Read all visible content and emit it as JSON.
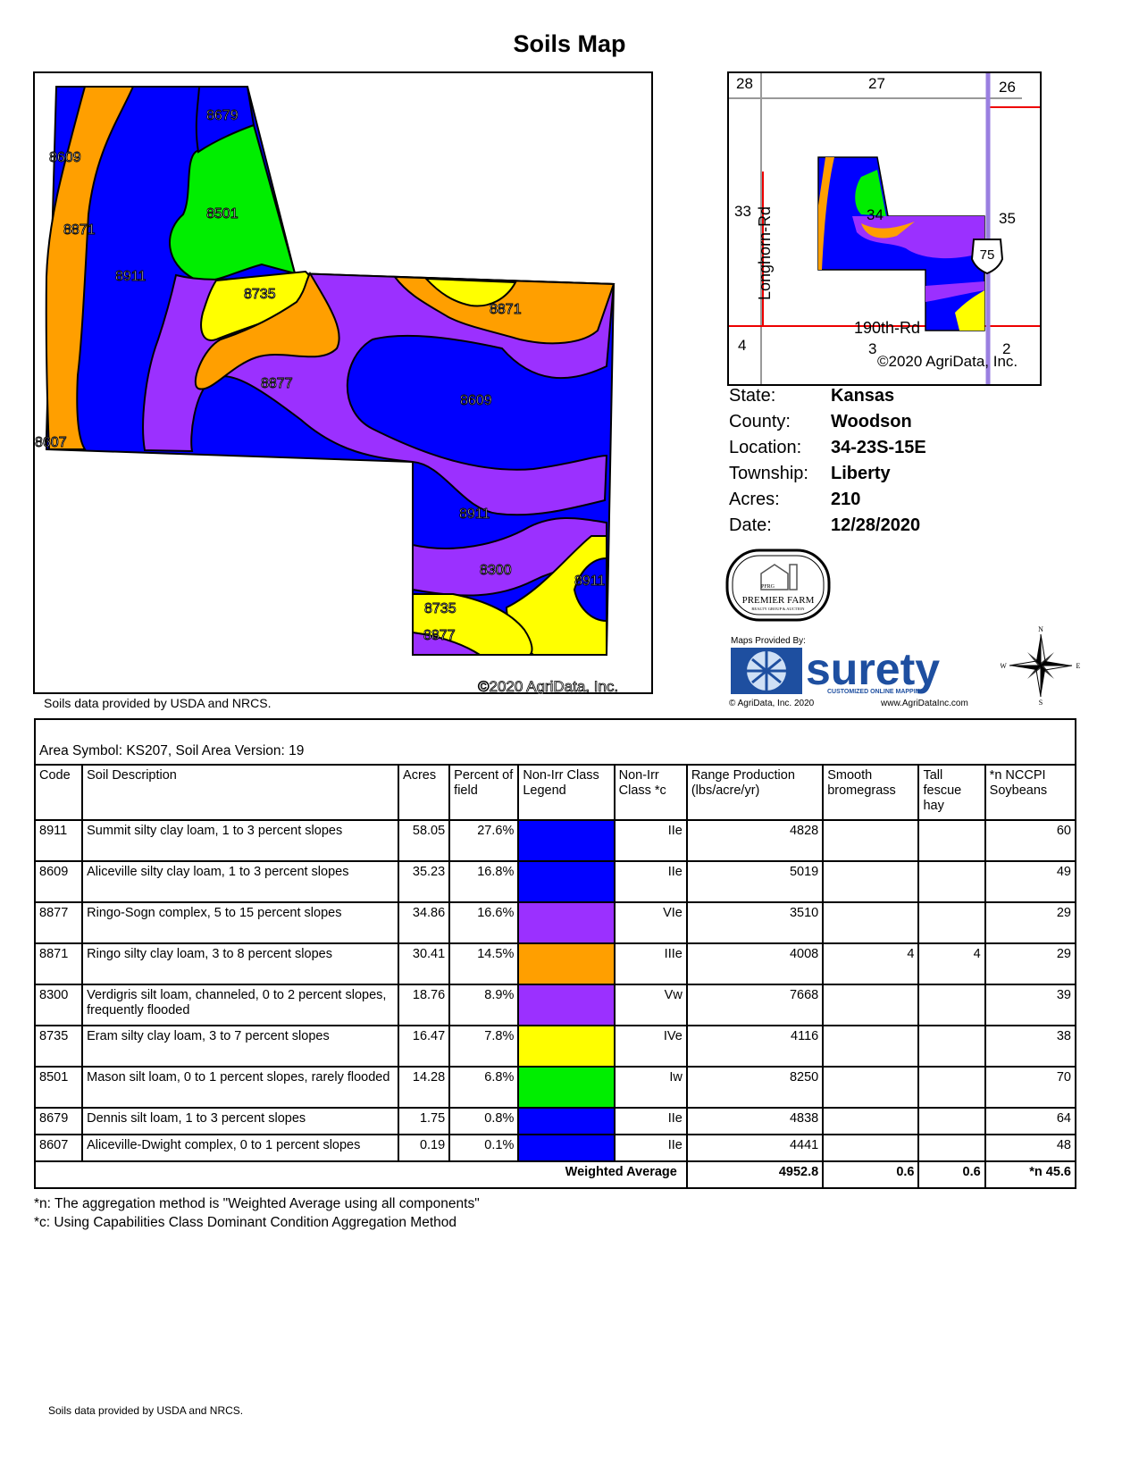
{
  "title": "Soils Map",
  "main_map": {
    "labels": [
      "8679",
      "8609",
      "8501",
      "8871",
      "8911",
      "8735",
      "8871",
      "8877",
      "8609",
      "8607",
      "8911",
      "8300",
      "8911",
      "8735",
      "8877"
    ],
    "copyright": "©2020 AgriData, Inc.",
    "colors": {
      "blue": "#0000ff",
      "purple": "#9b30ff",
      "orange": "#ff9f00",
      "yellow": "#ffff00",
      "green": "#00ee00"
    }
  },
  "main_credit": "Soils data provided by USDA and NRCS.",
  "locator": {
    "section_labels": [
      "28",
      "27",
      "26",
      "33",
      "34",
      "35",
      "4",
      "3",
      "2"
    ],
    "road_labels": [
      "Longhorn-Rd",
      "190th-Rd"
    ],
    "highway": "75",
    "copyright": "©2020 AgriData, Inc."
  },
  "info": {
    "rows": [
      {
        "label": "State:",
        "value": "Kansas"
      },
      {
        "label": "County:",
        "value": "Woodson"
      },
      {
        "label": "Location:",
        "value": "34-23S-15E"
      },
      {
        "label": "Township:",
        "value": "Liberty"
      },
      {
        "label": "Acres:",
        "value": "210"
      },
      {
        "label": "Date:",
        "value": "12/28/2020"
      }
    ]
  },
  "logos": {
    "pfrg_small": "PFRG",
    "pfrg_name": "PREMIER FARM",
    "pfrg_sub": "REALTY GROUP & AUCTION",
    "maps_provided_by": "Maps Provided By:",
    "surety": "surety",
    "surety_tag": "CUSTOMIZED ONLINE MAPPING",
    "copyright": "© AgriData, Inc. 2020",
    "url": "www.AgriDataInc.com"
  },
  "compass": {
    "n": "N",
    "s": "S",
    "e": "E",
    "w": "W"
  },
  "table": {
    "area_symbol": "Area Symbol: KS207, Soil Area Version: 19",
    "headers": [
      "Code",
      "Soil Description",
      "Acres",
      "Percent of field",
      "Non-Irr Class Legend",
      "Non-Irr Class *c",
      "Range Production (lbs/acre/yr)",
      "Smooth bromegrass",
      "Tall fescue hay",
      "*n NCCPI Soybeans"
    ],
    "rows": [
      {
        "code": "8911",
        "desc": "Summit silty clay loam, 1 to 3 percent slopes",
        "acres": "58.05",
        "pct": "27.6%",
        "color": "#0000ff",
        "cls": "IIe",
        "range": "4828",
        "brome": "",
        "fescue": "",
        "nccpi": "60"
      },
      {
        "code": "8609",
        "desc": "Aliceville silty clay loam, 1 to 3 percent slopes",
        "acres": "35.23",
        "pct": "16.8%",
        "color": "#0000ff",
        "cls": "IIe",
        "range": "5019",
        "brome": "",
        "fescue": "",
        "nccpi": "49"
      },
      {
        "code": "8877",
        "desc": "Ringo-Sogn complex, 5 to 15 percent slopes",
        "acres": "34.86",
        "pct": "16.6%",
        "color": "#9b30ff",
        "cls": "VIe",
        "range": "3510",
        "brome": "",
        "fescue": "",
        "nccpi": "29"
      },
      {
        "code": "8871",
        "desc": "Ringo silty clay loam, 3 to 8 percent slopes",
        "acres": "30.41",
        "pct": "14.5%",
        "color": "#ff9f00",
        "cls": "IIIe",
        "range": "4008",
        "brome": "4",
        "fescue": "4",
        "nccpi": "29"
      },
      {
        "code": "8300",
        "desc": "Verdigris silt loam, channeled, 0 to 2 percent slopes, frequently flooded",
        "acres": "18.76",
        "pct": "8.9%",
        "color": "#9b30ff",
        "cls": "Vw",
        "range": "7668",
        "brome": "",
        "fescue": "",
        "nccpi": "39"
      },
      {
        "code": "8735",
        "desc": "Eram silty clay loam, 3 to 7 percent slopes",
        "acres": "16.47",
        "pct": "7.8%",
        "color": "#ffff00",
        "cls": "IVe",
        "range": "4116",
        "brome": "",
        "fescue": "",
        "nccpi": "38"
      },
      {
        "code": "8501",
        "desc": "Mason silt loam, 0 to 1 percent slopes, rarely flooded",
        "acres": "14.28",
        "pct": "6.8%",
        "color": "#00ee00",
        "cls": "Iw",
        "range": "8250",
        "brome": "",
        "fescue": "",
        "nccpi": "70"
      },
      {
        "code": "8679",
        "desc": "Dennis silt loam, 1 to 3 percent slopes",
        "acres": "1.75",
        "pct": "0.8%",
        "color": "#0000ff",
        "cls": "IIe",
        "range": "4838",
        "brome": "",
        "fescue": "",
        "nccpi": "64"
      },
      {
        "code": "8607",
        "desc": "Aliceville-Dwight complex, 0 to 1 percent slopes",
        "acres": "0.19",
        "pct": "0.1%",
        "color": "#0000ff",
        "cls": "IIe",
        "range": "4441",
        "brome": "",
        "fescue": "",
        "nccpi": "48"
      }
    ],
    "avg_label": "Weighted Average",
    "avg_range": "4952.8",
    "avg_brome": "0.6",
    "avg_fescue": "0.6",
    "avg_nccpi": "*n 45.6"
  },
  "notes": [
    "*n: The aggregation method is \"Weighted Average using all components\"",
    "*c:  Using Capabilities Class Dominant Condition Aggregation Method"
  ],
  "bottom_credit": "Soils data provided by USDA and NRCS."
}
